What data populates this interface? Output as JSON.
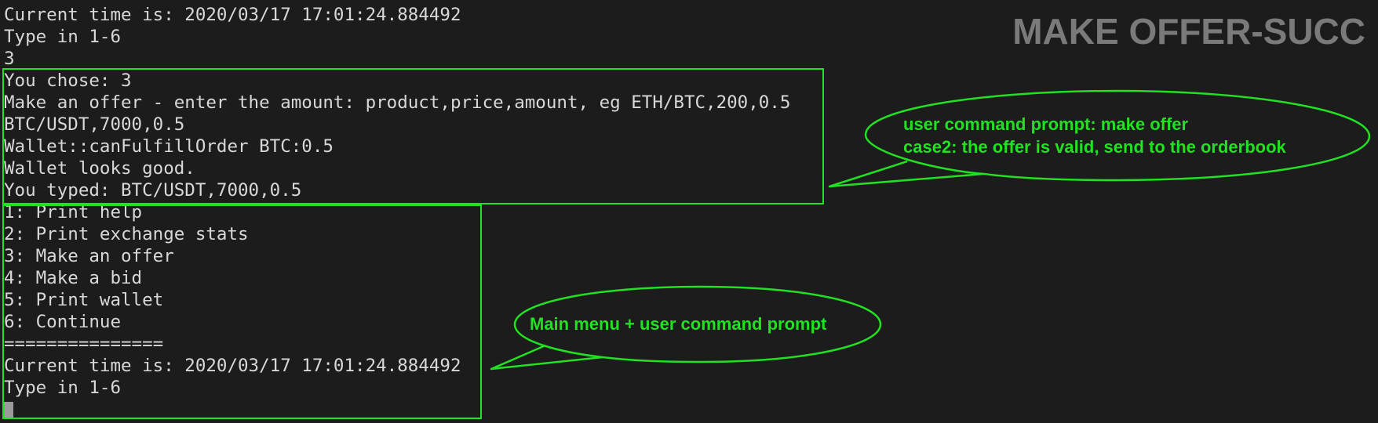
{
  "title": "MAKE OFFER-SUCC",
  "terminal": {
    "lines": [
      "Current time is: 2020/03/17 17:01:24.884492",
      "Type in 1-6",
      "3",
      "You chose: 3",
      "Make an offer - enter the amount: product,price,amount, eg ETH/BTC,200,0.5",
      "BTC/USDT,7000,0.5",
      "Wallet::canFulfillOrder BTC:0.5",
      "Wallet looks good.",
      "You typed: BTC/USDT,7000,0.5",
      "1: Print help",
      "2: Print exchange stats",
      "3: Make an offer",
      "4: Make a bid",
      "5: Print wallet",
      "6: Continue",
      "===============",
      "Current time is: 2020/03/17 17:01:24.884492",
      "Type in 1-6"
    ]
  },
  "callouts": {
    "offer": {
      "line1": "user command prompt: make offer",
      "line2": "case2: the offer is valid, send to the orderbook"
    },
    "menu": {
      "line1": "Main menu + user command prompt"
    }
  },
  "colors": {
    "background": "#1c1c1c",
    "terminal_text": "#d8d8d8",
    "annotation": "#22e022",
    "title": "#7a7a7a"
  }
}
